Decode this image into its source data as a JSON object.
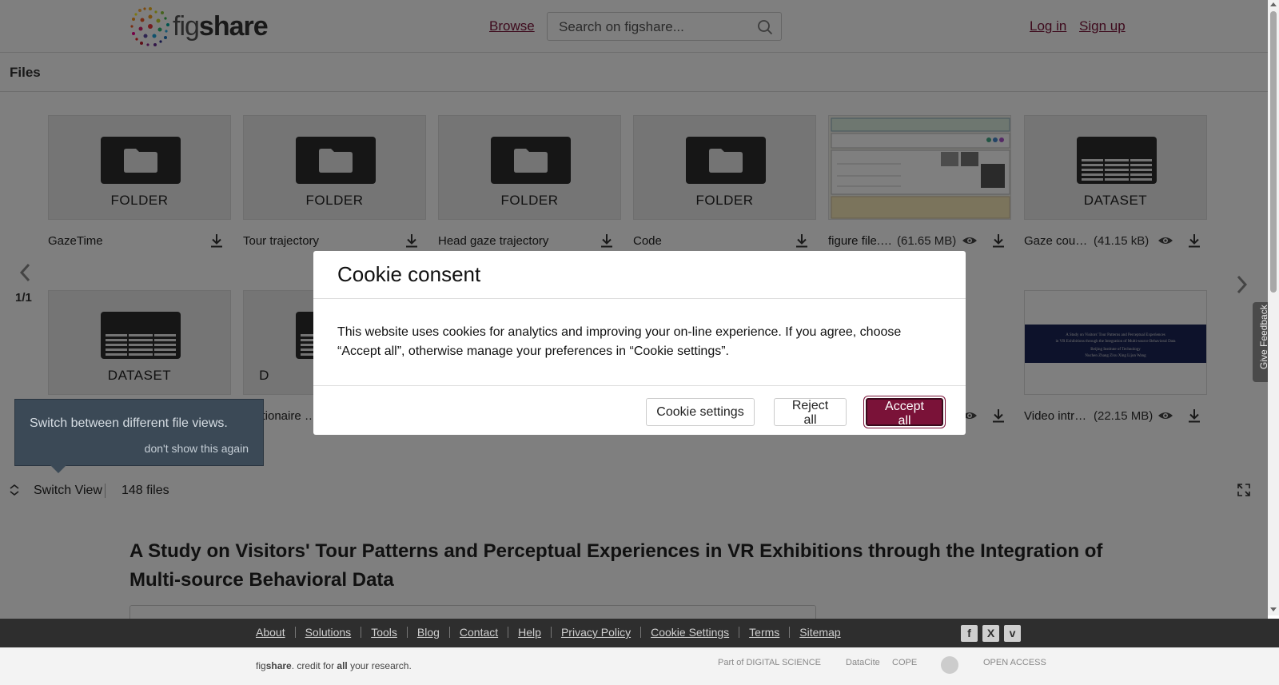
{
  "header": {
    "logo_text_light": "fig",
    "logo_text_bold": "share",
    "browse": "Browse",
    "search_placeholder": "Search on figshare...",
    "login": "Log in",
    "signup": "Sign up"
  },
  "files_section": {
    "title": "Files",
    "pager": "1/1",
    "row1": [
      {
        "type": "FOLDER",
        "name": "GazeTime",
        "size": ""
      },
      {
        "type": "FOLDER",
        "name": "Tour trajectory",
        "size": ""
      },
      {
        "type": "FOLDER",
        "name": "Head gaze trajectory",
        "size": ""
      },
      {
        "type": "FOLDER",
        "name": "Code",
        "size": ""
      },
      {
        "type": "image",
        "name": "figure file.p…",
        "size": "(61.65 MB)"
      },
      {
        "type": "DATASET",
        "name": "Gaze count…",
        "size": "(41.15 kB)"
      }
    ],
    "row2": [
      {
        "type": "DATASET",
        "name": "",
        "size": ""
      },
      {
        "type": "D",
        "name": "stionaire …",
        "size": ""
      },
      {
        "type": "video",
        "name": "Video intro…",
        "size": "(22.15 MB)"
      }
    ],
    "video_thumb_lines": [
      "A Study on Visitors' Tour Patterns and Perceptual Experiences",
      "in VR Exhibitions through the Integration of Multi-source Behavioral Data",
      "Beijing Institute of Technology",
      "Nuchen Zhang    Zixu Xing    Lijun Wang"
    ]
  },
  "tooltip": {
    "text": "Switch between different file views.",
    "dismiss": "don't show this again"
  },
  "switchbar": {
    "label": "Switch View",
    "count": "148 files"
  },
  "article": {
    "title": "A Study on Visitors' Tour Patterns and Perceptual Experiences in VR Exhibitions through the Integration of Multi-source Behavioral Data"
  },
  "cookie_modal": {
    "title": "Cookie consent",
    "body": "This website uses cookies for analytics and improving your on-line experience. If you agree, choose “Accept all”, otherwise manage your preferences in “Cookie settings”.",
    "settings_btn": "Cookie settings",
    "reject_btn": "Reject all",
    "accept_btn": "Accept all"
  },
  "feedback": "Give Feedback",
  "footer": {
    "links": [
      "About",
      "Solutions",
      "Tools",
      "Blog",
      "Contact",
      "Help",
      "Privacy Policy",
      "Cookie Settings",
      "Terms",
      "Sitemap"
    ],
    "social": [
      "f",
      "X",
      "v"
    ],
    "tagline_pre": "fig",
    "tagline_bold": "share",
    "tagline_mid": ". credit for ",
    "tagline_bold2": "all",
    "tagline_end": " your research.",
    "partners": [
      "Part of DIGITAL SCIENCE",
      "DataCite",
      "COPE",
      "OPEN ACCESS"
    ]
  },
  "colors": {
    "brand": "#7a1238",
    "overlay": "rgba(0,0,0,0.5)",
    "footer_bg": "#2e2e2e"
  }
}
